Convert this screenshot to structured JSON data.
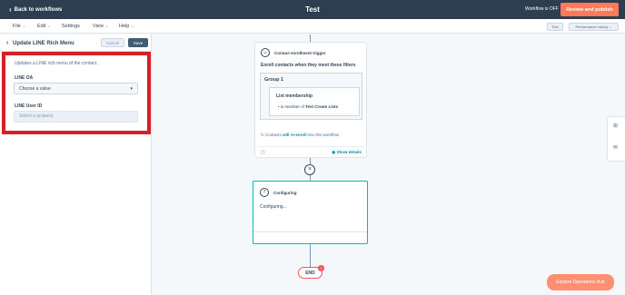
{
  "topbar": {
    "back_label": "Back to workflows",
    "title": "Test",
    "workflow_status": "Workflow is OFF",
    "publish_label": "Review and publish"
  },
  "menubar": {
    "items": [
      "File",
      "Edit",
      "Settings",
      "View",
      "Help"
    ],
    "test_label": "Test",
    "performance_label": "Performance history"
  },
  "panel": {
    "title": "Update LINE Rich Menu",
    "cancel_label": "Cancel",
    "save_label": "Save",
    "description": "Updates a LINE rich menu of the contact.",
    "line_oa": {
      "label": "LINE OA",
      "value": "Choose a value"
    },
    "line_user_id": {
      "label": "LINE User ID",
      "placeholder": "Select a property"
    }
  },
  "trigger_card": {
    "title": "Contact enrollment trigger",
    "subtitle": "Enroll contacts when they meet these filters",
    "group_title": "Group 1",
    "list_title": "List membership",
    "condition_prefix": "is member of",
    "condition_value": "Test Create Lists",
    "reenroll_prefix": "Contacts",
    "reenroll_link": "will re-enroll",
    "reenroll_suffix": "into this workflow",
    "show_details": "Show details"
  },
  "config_card": {
    "title": "Configuring",
    "body": "Configuring..."
  },
  "end": {
    "label": "END",
    "badge": "!"
  },
  "ops_hub_label": "Explore Operations Hub",
  "colors": {
    "topbar_bg": "#2d3e50",
    "publish_btn": "#ff7a59",
    "highlight_border": "#d71f26",
    "accent_teal": "#00bda5",
    "link": "#0091ae"
  }
}
